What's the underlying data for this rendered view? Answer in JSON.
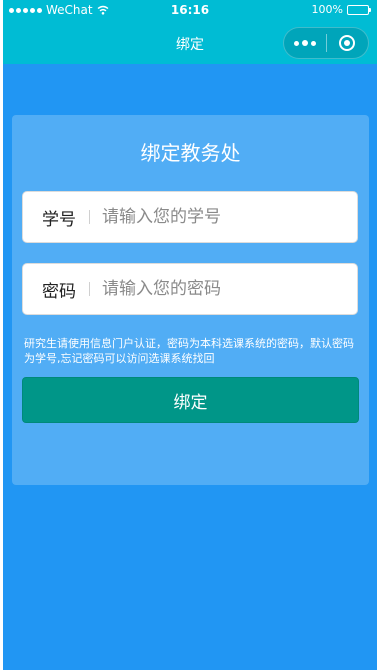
{
  "status_bar": {
    "carrier": "WeChat",
    "time": "16:16",
    "battery": "100%",
    "signal_icon": "signal-dots-icon",
    "wifi_icon": "wifi-icon",
    "battery_icon": "battery-icon"
  },
  "nav": {
    "title": "绑定",
    "more_icon": "more-dots-icon",
    "close_icon": "close-circle-icon"
  },
  "card": {
    "title": "绑定教务处",
    "student_id": {
      "label": "学号",
      "placeholder": "请输入您的学号",
      "value": ""
    },
    "password": {
      "label": "密码",
      "placeholder": "请输入您的密码",
      "value": ""
    },
    "hint": "研究生请使用信息门户认证，密码为本科选课系统的密码，默认密码为学号,忘记密码可以访问选课系统找回",
    "button_label": "绑定"
  },
  "colors": {
    "background": "#2196f3",
    "nav_bar": "#00bcd4",
    "button": "#009688"
  }
}
